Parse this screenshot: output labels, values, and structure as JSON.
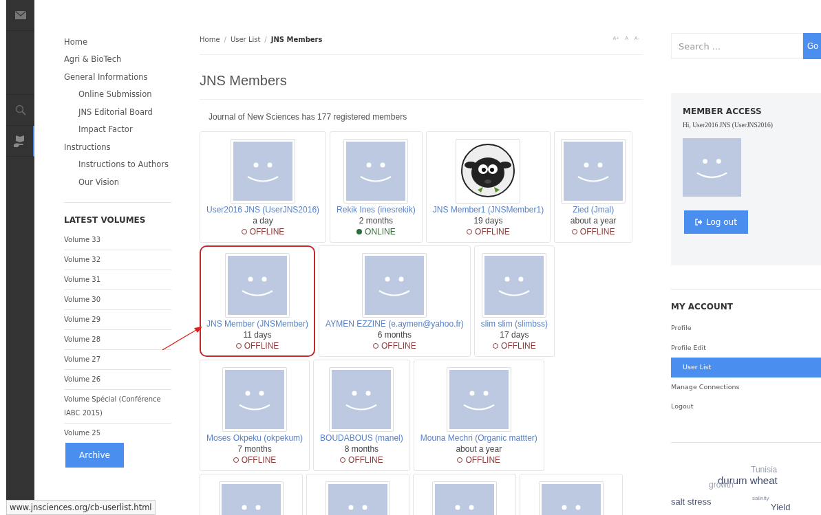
{
  "nav": {
    "items": [
      {
        "label": "Home"
      },
      {
        "label": "Agri & BioTech"
      },
      {
        "label": "General Informations",
        "children": [
          {
            "label": "Online Submission"
          },
          {
            "label": "JNS Editorial Board"
          },
          {
            "label": "Impact Factor"
          }
        ]
      },
      {
        "label": "Instructions",
        "children": [
          {
            "label": "Instructions to Authors"
          },
          {
            "label": "Our Vision"
          }
        ]
      }
    ]
  },
  "latest_volumes": {
    "title": "LATEST VOLUMES",
    "items": [
      "Volume 33",
      "Volume 32",
      "Volume 31",
      "Volume 30",
      "Volume 29",
      "Volume 28",
      "Volume 27",
      "Volume 26",
      "Volume Spécial (Conférence IABC 2015)",
      "Volume 25"
    ],
    "button": "Archive"
  },
  "breadcrumb": {
    "items": [
      {
        "label": "Home",
        "separator": "/"
      },
      {
        "label": "User List",
        "separator": "/"
      }
    ],
    "current": "JNS Members"
  },
  "font_controls": [
    "A+",
    "A",
    "A-"
  ],
  "page_title": "JNS Members",
  "summary": "Journal of New Sciences has 177 registered members",
  "members": [
    {
      "kind": "default",
      "name": "User2016 JNS (UserJNS2016)",
      "since": "a day",
      "online": false,
      "status": "OFFLINE",
      "highlighted": false
    },
    {
      "kind": "default",
      "name": "Rekik Ines (inesrekik)",
      "since": "2 months",
      "online": true,
      "status": "ONLINE",
      "highlighted": false
    },
    {
      "kind": "sheep",
      "name": "JNS Member1 (JNSMember1)",
      "since": "19 days",
      "online": false,
      "status": "OFFLINE",
      "highlighted": false
    },
    {
      "kind": "default",
      "name": "Zied (Jmal)",
      "since": "about a year",
      "online": false,
      "status": "OFFLINE",
      "highlighted": false
    },
    {
      "kind": "default",
      "name": "JNS Member (JNSMember)",
      "since": "11 days",
      "online": false,
      "status": "OFFLINE",
      "highlighted": true
    },
    {
      "kind": "default",
      "name": "AYMEN EZZINE (e.aymen@yahoo.fr)",
      "since": "6 months",
      "online": false,
      "status": "OFFLINE",
      "highlighted": false
    },
    {
      "kind": "default",
      "name": "slim slim (slimbss)",
      "since": "17 days",
      "online": false,
      "status": "OFFLINE",
      "highlighted": false
    },
    {
      "kind": "default",
      "name": "Moses Okpeku (okpekum)",
      "since": "7 months",
      "online": false,
      "status": "OFFLINE",
      "highlighted": false
    },
    {
      "kind": "default",
      "name": "BOUDABOUS (manel)",
      "since": "8 months",
      "online": false,
      "status": "OFFLINE",
      "highlighted": false
    },
    {
      "kind": "default",
      "name": "Mouna Mechri (Organic mattter)",
      "since": "about a year",
      "online": false,
      "status": "OFFLINE",
      "highlighted": false
    },
    {
      "kind": "default",
      "highlighted": false
    },
    {
      "kind": "default",
      "highlighted": false
    },
    {
      "kind": "default",
      "highlighted": false
    },
    {
      "kind": "default",
      "highlighted": false
    }
  ],
  "search": {
    "placeholder": "Search ...",
    "button": "Go"
  },
  "member_access": {
    "title": "MEMBER ACCESS",
    "greeting": "Hi, User2016 JNS (UserJNS2016)",
    "button": "Log out"
  },
  "my_account": {
    "title": "MY ACCOUNT",
    "items": [
      {
        "label": "Profile",
        "selected": false
      },
      {
        "label": "Profile Edit",
        "selected": false
      },
      {
        "label": "User List",
        "selected": true
      },
      {
        "label": "Manage Connections",
        "selected": false
      },
      {
        "label": "Logout",
        "selected": false
      }
    ]
  },
  "tag_cloud": [
    {
      "text": "Tunisia",
      "kind": "faint"
    },
    {
      "text": "durum wheat",
      "kind": "large"
    },
    {
      "text": "growth",
      "kind": "faint"
    },
    {
      "text": "salt stress",
      "kind": "medium"
    },
    {
      "text": "salinity",
      "kind": "tiny"
    },
    {
      "text": "Yield",
      "kind": "medium"
    }
  ],
  "status_url": "www.jnsciences.org/cb-userlist.html"
}
